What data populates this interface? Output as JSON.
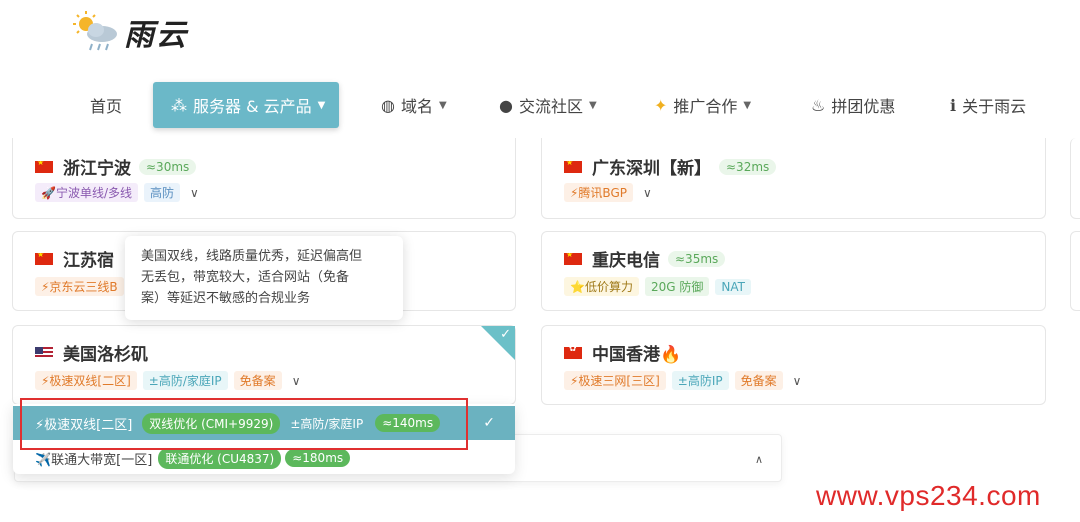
{
  "brand": {
    "name": "雨云"
  },
  "nav": {
    "home": "首页",
    "servers": "服务器 & 云产品",
    "domains": "域名",
    "community": "交流社区",
    "promo": "推广合作",
    "group_buy": "拼团优惠",
    "about": "关于雨云"
  },
  "regions": [
    {
      "name": "浙江宁波",
      "flag": "cn",
      "ping": "≈30ms",
      "tags": [
        "🚀宁波单线/多线",
        "高防"
      ]
    },
    {
      "name": "广东深圳【新】",
      "flag": "cn",
      "ping": "≈32ms",
      "tags": [
        "⚡腾讯BGP"
      ]
    },
    {
      "name": "江苏宿迁",
      "name_visible": "江苏宿",
      "flag": "cn",
      "tags": [
        "⚡京东云三线"
      ],
      "tag_visible": "⚡京东云三线B"
    },
    {
      "name": "重庆电信",
      "flag": "cn",
      "ping": "≈35ms",
      "tags": [
        "⭐低价算力",
        "20G 防御",
        "NAT"
      ]
    },
    {
      "name": "美国洛杉矶",
      "flag": "us",
      "tags": [
        "⚡极速双线[二区]",
        "±高防/家庭IP",
        "免备案"
      ],
      "selected": true
    },
    {
      "name": "中国香港🔥",
      "flag": "hk",
      "tags": [
        "⚡极速三网[三区]",
        "±高防IP",
        "免备案"
      ]
    }
  ],
  "tooltip": {
    "line1": "美国双线，线路质量优秀，延迟偏高但",
    "line2": "无丢包，带宽较大，适合网站（免备",
    "line3": "案）等延迟不敏感的合规业务"
  },
  "dropdown": {
    "options": [
      {
        "label": "⚡极速双线[二区]",
        "route": "双线优化 (CMI+9929)",
        "extra": "±高防/家庭IP",
        "ping": "≈140ms",
        "selected": true
      },
      {
        "label": "✈️联通大带宽[一区]",
        "route": "联通优化 (CU4837)",
        "ping": "≈180ms",
        "selected": false
      }
    ]
  },
  "watermark": "www.vps234.com",
  "colors": {
    "accent": "#6bb8c8",
    "ping_green": "#5cb85c",
    "highlight_red": "#e03030"
  }
}
